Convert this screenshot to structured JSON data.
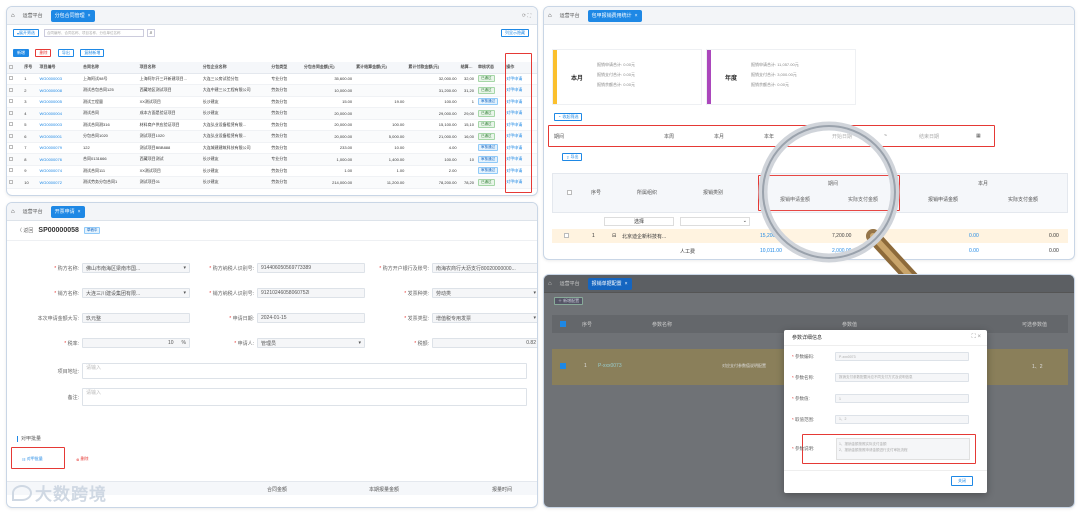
{
  "p1": {
    "tabs": [
      "运营平台",
      "分包合同管理"
    ],
    "toolbar": {
      "search_btn": "展开筛选",
      "search_placeholder": "合同编号、合同名称、项目名称、分包单位名称",
      "right_btn": "列显示隐藏"
    },
    "actions": [
      "新增",
      "删除",
      "导出",
      "复制新增"
    ],
    "columns": [
      "序号",
      "项目编号",
      "合同名称",
      "项目名称",
      "分包企业名称",
      "分包类型",
      "分包合同金额(元)",
      "累计结算金额(元)",
      "累计付款金额(元)",
      "结算金额",
      "审核状态",
      "操作"
    ],
    "rows": [
      {
        "no": "1",
        "code": "WG0000003",
        "name": "上海阿试98号",
        "proj": "上海阿尔开三环新建项目...",
        "sub": "大连三公房试验分包",
        "type": "专业分包",
        "amt": "35,600.00",
        "settled": "",
        "paid": "32,000.00",
        "s": "32,00",
        "status": "已通过",
        "op": "对甲申请"
      },
      {
        "no": "2",
        "code": "WG0000008",
        "name": "测试合包合同125",
        "proj": "西藏地区测试项目",
        "sub": "大连中建三公工程有限公司",
        "type": "劳务分包",
        "amt": "10,000.00",
        "settled": "",
        "paid": "31,200.00",
        "s": "31,20",
        "status": "已通过",
        "op": "对甲申请"
      },
      {
        "no": "3",
        "code": "WG0000005",
        "name": "测试工程量",
        "proj": "XX测试项目",
        "sub": "长沙建友",
        "type": "劳务分包",
        "amt": "15.00",
        "settled": "19.00",
        "paid": "100.00",
        "s": "1",
        "status": "审核通过",
        "op": "对甲申请"
      },
      {
        "no": "4",
        "code": "WG0000004",
        "name": "测试合同",
        "proj": "成本方面是验证项目",
        "sub": "长沙建友",
        "type": "劳务分包",
        "amt": "20,000.00",
        "settled": "",
        "paid": "29,000.00",
        "s": "29,00",
        "status": "已通过",
        "op": "对甲申请"
      },
      {
        "no": "5",
        "code": "WG0000003",
        "name": "测试合同测316",
        "proj": "材料商户供应验证项目",
        "sub": "大连弘业设备租赁有限...",
        "type": "劳务分包",
        "amt": "20,000.00",
        "settled": "100.00",
        "paid": "15,100.00",
        "s": "15,10",
        "status": "已通过",
        "op": "对甲申请"
      },
      {
        "no": "6",
        "code": "WG0000001",
        "name": "分包合同1020",
        "proj": "测试项目1020",
        "sub": "大连弘业设备租赁有限...",
        "type": "劳务分包",
        "amt": "20,000.00",
        "settled": "5,000.00",
        "paid": "21,000.00",
        "s": "16,00",
        "status": "已通过",
        "op": "对甲申请"
      },
      {
        "no": "7",
        "code": "WG0000079",
        "name": "122",
        "proj": "测试项目BBB888",
        "sub": "大连城建建筑科技有限公司",
        "type": "劳务分包",
        "amt": "233.00",
        "settled": "10.00",
        "paid": "4.00",
        "s": "",
        "status": "审核通过",
        "op": "对甲申请"
      },
      {
        "no": "8",
        "code": "WG0000076",
        "name": "合同0131666",
        "proj": "西藏项目测试",
        "sub": "长沙建友",
        "type": "专业分包",
        "amt": "1,000.00",
        "settled": "1,400.00",
        "paid": "100.00",
        "s": "10",
        "status": "审核通过",
        "op": "对甲申请"
      },
      {
        "no": "9",
        "code": "WG0000074",
        "name": "测试合同111",
        "proj": "XX测试项目",
        "sub": "长沙建友",
        "type": "劳务分包",
        "amt": "1.00",
        "settled": "1.00",
        "paid": "2.00",
        "s": "",
        "status": "审核通过",
        "op": "对甲申请"
      },
      {
        "no": "10",
        "code": "WG0000072",
        "name": "测试劳务分包合同1",
        "proj": "测试项目01",
        "sub": "长沙建友",
        "type": "劳务分包",
        "amt": "214,000.00",
        "settled": "11,200.00",
        "paid": "78,200.00",
        "s": "78,20",
        "status": "已通过",
        "op": "对甲申请"
      }
    ]
  },
  "p2": {
    "tabs": [
      "运营平台",
      "开票申请"
    ],
    "back": "返回",
    "doc_no": "SP00000058",
    "status": "草稿中",
    "fields": [
      {
        "label": "购方名称:",
        "value": "佛山市南海区梁南市国...",
        "req": true
      },
      {
        "label": "购方纳税人识别号:",
        "value": "914406050569773389",
        "req": true
      },
      {
        "label": "购方开户银行及账号:",
        "value": "南海农商行大沥支行80020000000...",
        "req": true
      },
      {
        "label": "销方名称:",
        "value": "大连三川建设集团有限...",
        "req": true
      },
      {
        "label": "销方纳税人识别号:",
        "value": "91210246058060752l",
        "req": true
      },
      {
        "label": "发票种类:",
        "value": "劳动类",
        "req": true
      },
      {
        "label": "本次申请金额大写:",
        "value": "玖元整",
        "req": false
      },
      {
        "label": "申请日期:",
        "value": "2024-01-15",
        "req": true
      },
      {
        "label": "发票类型:",
        "value": "增值税专用发票",
        "req": true
      },
      {
        "label": "税率:",
        "value": "10",
        "unit": "%",
        "req": true
      },
      {
        "label": "申请人:",
        "value": "管理员",
        "req": true
      },
      {
        "label": "税额:",
        "value": "0.82",
        "req": true
      },
      {
        "label": "项目地址:",
        "value": "请输入",
        "req": false
      },
      {
        "label": "备注:",
        "value": "请输入",
        "req": false
      }
    ],
    "section": "对甲批量",
    "btn_batch": "对甲批量",
    "btn_delete": "删除",
    "cols": [
      "合同金额",
      "本期报量金额",
      "报量时间"
    ],
    "brand": "大数跨境"
  },
  "p3": {
    "tabs": [
      "运营平台",
      "包甲报销费用统计"
    ],
    "stats": [
      {
        "title": "本月",
        "lines": [
          "报销申请合计: 0.00元",
          "报销支付合计: 0.00元",
          "报销余额合计: 0.00元"
        ]
      },
      {
        "title": "年度",
        "lines": [
          "报销申请合计: 11,057.00元",
          "报销支付合计: 3,000.00元",
          "报销余额合计: 0.00元"
        ]
      }
    ],
    "filter_btn": "收起筛选",
    "filter": {
      "label": "期间",
      "opts": [
        "本周",
        "本月",
        "本年"
      ],
      "start": "开始日期",
      "sep": "~",
      "end": "结束日期"
    },
    "export": "导出",
    "cols": [
      "序号",
      "所属组织",
      "报销类别",
      "期间",
      "本月"
    ],
    "sub_period": [
      "报销申请金额",
      "实际支付金额"
    ],
    "sub_month": [
      "报销申请金额",
      "实际支付金额"
    ],
    "select": "选择",
    "row1": {
      "no": "1",
      "org": "北京迪企新科技有...",
      "a": "15,200.00",
      "b": "7,200.00",
      "c": "0.00",
      "d": "0.00"
    },
    "row2": {
      "cat": "人工费",
      "a": "10,011.00",
      "b": "2,000.00",
      "c": "0.00",
      "d": "0.00"
    }
  },
  "p4": {
    "tabs": [
      "运营平台",
      "报销单据配置"
    ],
    "add_btn": "新增配置",
    "cols": [
      "序号",
      "参数名称",
      "参数值",
      "可选参数值"
    ],
    "row": {
      "no": "1",
      "name": "P-xxx0073",
      "desc": "对应支付参数值说明配置",
      "vals": "1、2"
    },
    "modal": {
      "title": "参数详细信息",
      "fields": [
        {
          "label": "参数编码:",
          "value": "P-xxx0073"
        },
        {
          "label": "参数名称:",
          "value": "报销支付参数配置对应不同支付方式及说明信息"
        },
        {
          "label": "参数值:",
          "value": "1"
        },
        {
          "label": "取值范围:",
          "value": "1、2"
        }
      ],
      "desc_label": "参数说明:",
      "desc_lines": [
        "1、报销金额按照实际支付金额",
        "2、报销金额按照申请金额进行支付审批流程"
      ],
      "close": "关闭"
    }
  }
}
